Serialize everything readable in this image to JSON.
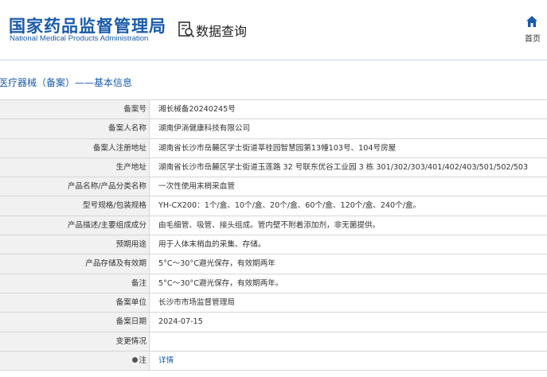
{
  "header": {
    "logo_cn": "国家药品监督管理局",
    "logo_en": "National Medical Products Administration",
    "query_title": "数据查询",
    "home_label": "首页"
  },
  "breadcrumb": "医疗器械（备案）——基本信息",
  "rows": [
    {
      "label": "备案号",
      "value": "湘长械备20240245号"
    },
    {
      "label": "备案人名称",
      "value": "湖南伊淌健康科技有限公司"
    },
    {
      "label": "备案人注册地址",
      "value": "湖南省长沙市岳麓区学士街道莘桂园智慧园第13幢103号、104号房屋"
    },
    {
      "label": "生产地址",
      "value": "湖南省长沙市岳麓区学士街道玉莲路 32 号联东优谷工业园 3 栋 301/302/303/401/402/403/501/502/503"
    },
    {
      "label": "产品名称/产品分类名称",
      "value": "一次性使用末梢采血管"
    },
    {
      "label": "型号规格/包装规格",
      "value": "YH-CX200：1个/盒、10个/盒、20个/盒、60个/盒、120个/盒、240个/盒。"
    },
    {
      "label": "产品描述/主要组成成分",
      "value": "由毛细管、吸管、接头组成。管内壁不附着添加剂，非无菌提供。"
    },
    {
      "label": "预期用途",
      "value": "用于人体末梢血的采集、存储。"
    },
    {
      "label": "产品存储及有效期",
      "value": "5°C～30°C避光保存，有效期两年"
    },
    {
      "label": "备注",
      "value": "5°C～30°C避光保存，有效期两年。"
    },
    {
      "label": "备案单位",
      "value": "长沙市市场监督管理局"
    },
    {
      "label": "备案日期",
      "value": "2024-07-15"
    },
    {
      "label": "变更情况",
      "value": ""
    },
    {
      "label": "注",
      "value": "详情"
    }
  ],
  "colors": {
    "brand": "#1a5ba8",
    "label_bg": "#f1f1f1",
    "border": "#d6d6d6"
  }
}
